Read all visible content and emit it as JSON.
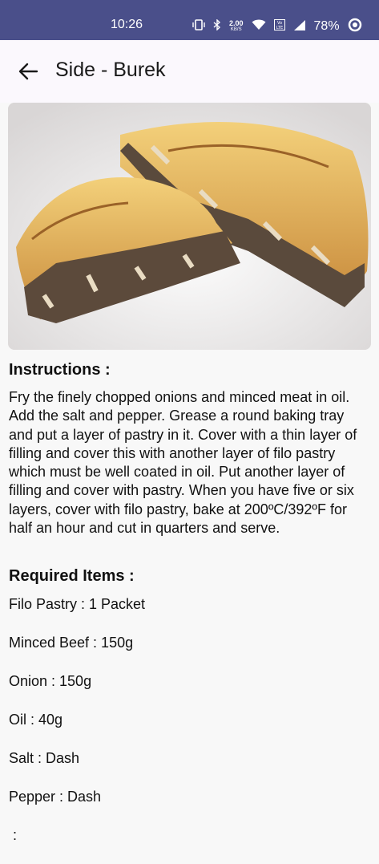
{
  "status_bar": {
    "time": "10:26",
    "speed_value": "2.00",
    "speed_unit": "KB/S",
    "battery": "78%"
  },
  "app_bar": {
    "title": "Side - Burek",
    "back_icon": "arrow-left-icon"
  },
  "recipe": {
    "image_alt": "Burek pastry with minced meat filling",
    "instructions_heading": "Instructions :",
    "instructions": "Fry the finely chopped onions and minced meat in oil. Add the salt and pepper. Grease a round baking tray and put a layer of pastry in it. Cover with a thin layer of filling and cover this with another layer of filo pastry which must be well coated in oil. Put another layer of filling and cover with pastry. When you have five or six layers, cover with filo pastry, bake at 200ºC/392ºF for half an hour and cut in quarters and serve.",
    "items_heading": "Required Items :",
    "items": [
      "Filo Pastry : 1 Packet",
      "Minced Beef : 150g",
      "Onion : 150g",
      "Oil : 40g",
      "Salt : Dash",
      "Pepper : Dash",
      " :"
    ]
  },
  "colors": {
    "status_bar": "#4a4f8a",
    "app_bar": "#fbf8fd",
    "background": "#f8f8f8"
  }
}
